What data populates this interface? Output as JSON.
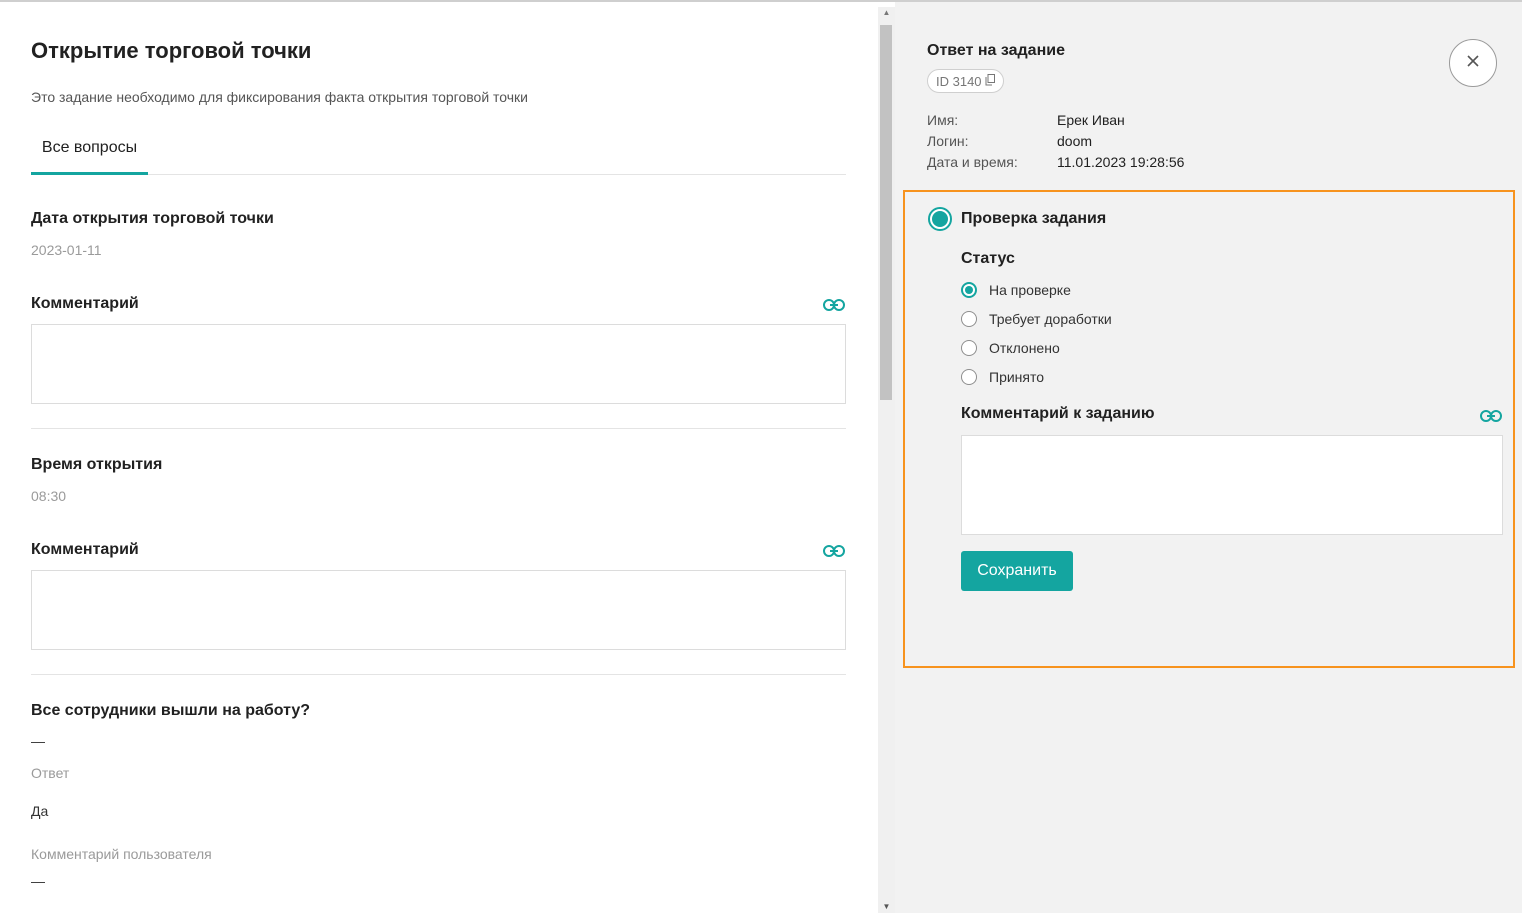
{
  "task": {
    "title": "Открытие торговой точки",
    "description": "Это задание необходимо для фиксирования факта открытия торговой точки",
    "tabs": [
      {
        "label": "Все вопросы",
        "active": true
      }
    ]
  },
  "questions": [
    {
      "title": "Дата открытия торговой точки",
      "value": "2023-01-11",
      "comment_label": "Комментарий"
    },
    {
      "title": "Время открытия",
      "value": "08:30",
      "comment_label": "Комментарий"
    },
    {
      "title": "Все сотрудники вышли на работу?",
      "value": "—",
      "answer_label": "Ответ",
      "answer_value": "Да",
      "user_comment_label": "Комментарий пользователя",
      "user_comment_value": "—"
    }
  ],
  "response": {
    "title": "Ответ на задание",
    "id_label": "ID 3140",
    "fields": [
      {
        "label": "Имя:",
        "value": "Ерек Иван"
      },
      {
        "label": "Логин:",
        "value": "doom"
      },
      {
        "label": "Дата и время:",
        "value": "11.01.2023 19:28:56"
      }
    ]
  },
  "review": {
    "title": "Проверка задания",
    "status_label": "Статус",
    "statuses": [
      {
        "label": "На проверке",
        "selected": true
      },
      {
        "label": "Требует доработки",
        "selected": false
      },
      {
        "label": "Отклонено",
        "selected": false
      },
      {
        "label": "Принято",
        "selected": false
      }
    ],
    "comment_label": "Комментарий к заданию",
    "comment_value": "",
    "save_label": "Сохранить"
  },
  "icons": {
    "close": "close-icon",
    "copy": "copy-icon",
    "link": "link-icon"
  },
  "colors": {
    "accent": "#14a5a0",
    "highlight": "#f7931e",
    "panel_bg": "#f2f2f2"
  }
}
